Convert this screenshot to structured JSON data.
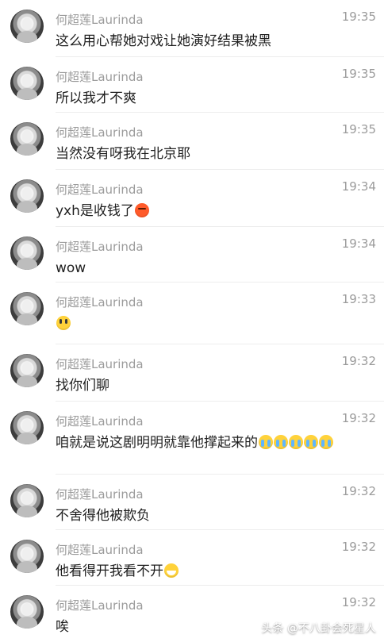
{
  "comments": [
    {
      "name": "何超莲Laurinda",
      "time": "19:35",
      "text": "这么用心帮她对戏让她演好结果被黑",
      "emojis": []
    },
    {
      "name": "何超莲Laurinda",
      "time": "19:35",
      "text": "所以我才不爽",
      "emojis": []
    },
    {
      "name": "何超莲Laurinda",
      "time": "19:35",
      "text": "当然没有呀我在北京耶",
      "emojis": []
    },
    {
      "name": "何超莲Laurinda",
      "time": "19:34",
      "text": "yxh是收钱了",
      "emojis": [
        "angry-emoji"
      ]
    },
    {
      "name": "何超莲Laurinda",
      "time": "19:34",
      "text": "wow",
      "emojis": []
    },
    {
      "name": "何超莲Laurinda",
      "time": "19:33",
      "text": "",
      "emojis": [
        "scared-emoji"
      ]
    },
    {
      "name": "何超莲Laurinda",
      "time": "19:32",
      "text": "找你们聊",
      "emojis": []
    },
    {
      "name": "何超莲Laurinda",
      "time": "19:32",
      "text": "咱就是说这剧明明就靠他撑起来的",
      "emojis": [
        "cry-emoji",
        "cry-emoji",
        "cry-emoji",
        "cry-emoji",
        "cry-emoji"
      ]
    },
    {
      "name": "何超莲Laurinda",
      "time": "19:32",
      "text": "不舍得他被欺负",
      "emojis": []
    },
    {
      "name": "何超莲Laurinda",
      "time": "19:32",
      "text": "他看得开我看不开",
      "emojis": [
        "laugh-emoji"
      ]
    },
    {
      "name": "何超莲Laurinda",
      "time": "19:32",
      "text": "唉",
      "emojis": []
    }
  ],
  "watermark": "头条 @不八卦会死星人",
  "colors": {
    "background": "#ffffff",
    "name": "#9b9b9b",
    "time": "#9b9b9b",
    "text": "#1f1f1f",
    "divider": "#ededed"
  }
}
